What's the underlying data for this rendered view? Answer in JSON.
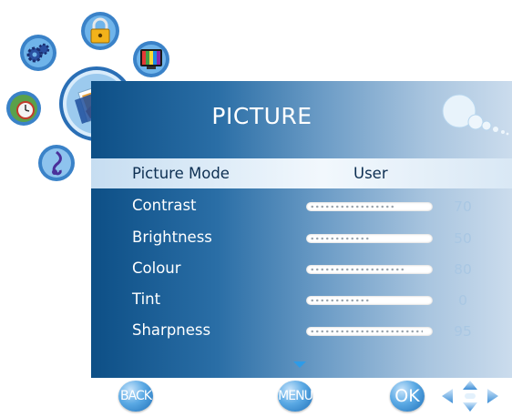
{
  "menu": {
    "title": "PICTURE",
    "picture_mode": {
      "label": "Picture Mode",
      "value": "User"
    },
    "settings": [
      {
        "label": "Contrast",
        "value": "70",
        "level": 0.7
      },
      {
        "label": "Brightness",
        "value": "50",
        "level": 0.5
      },
      {
        "label": "Colour",
        "value": "80",
        "level": 0.8
      },
      {
        "label": "Tint",
        "value": "0",
        "level": 0.5
      },
      {
        "label": "Sharpness",
        "value": "95",
        "level": 0.95
      }
    ]
  },
  "nav": {
    "back_label": "BACK",
    "menu_label": "MENU",
    "ok_label": "OK"
  },
  "side_icons": [
    "lock-icon",
    "tv-icon",
    "gear-icon",
    "picture-icon",
    "clock-icon",
    "music-note-icon"
  ],
  "colors": {
    "panel_left": "#0d4f86",
    "panel_right": "#cbdced",
    "highlight": "#f2f8fd",
    "button_blue": "#1f6fb8"
  }
}
